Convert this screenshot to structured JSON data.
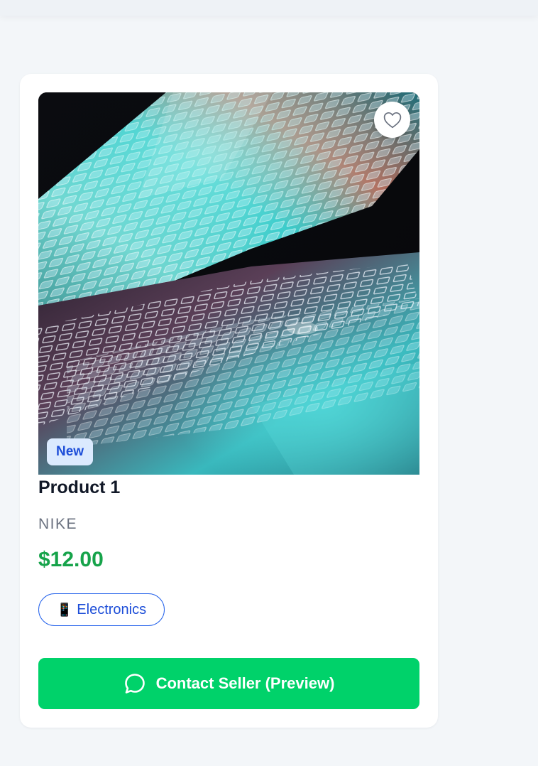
{
  "product": {
    "title": "Product 1",
    "brand": "NIKE",
    "price": "$12.00",
    "badge": "New",
    "category": {
      "emoji": "📱",
      "label": "Electronics"
    },
    "image": {
      "subject": "laptop-keyboard-photo"
    }
  },
  "actions": {
    "favorite_icon": "heart-outline-icon",
    "contact_icon": "chat-bubble-icon",
    "contact_label": "Contact Seller (Preview)"
  },
  "colors": {
    "page_bg": "#f3f6f9",
    "card_bg": "#ffffff",
    "title": "#111827",
    "brand": "#6b7280",
    "price": "#16a34a",
    "badge_bg": "#dbeafe",
    "badge_text": "#1d4ed8",
    "chip_border": "#2563eb",
    "cta_bg": "#00d26a",
    "cta_text": "#ffffff"
  }
}
